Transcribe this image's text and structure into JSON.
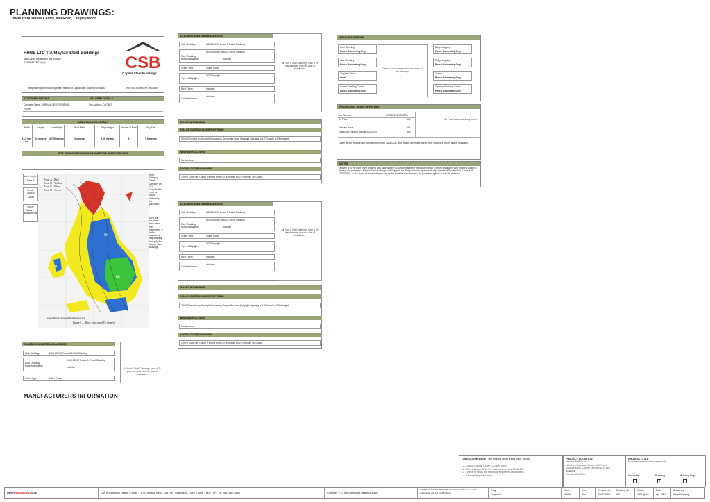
{
  "header": {
    "title": "PLANNING DRAWINGS:",
    "subtitle": "Littleburn Business Centre, Mill Road, Langley Moor"
  },
  "company": {
    "name": "HHGB LTD T/A Mayfair Steel Buildings",
    "address_line1": "Mill Lane, Littleburn Ind Estate",
    "address_line2": "07831027277(ph)",
    "tagline": "Independently owned and operated reseller of Capital Steel Buildings products",
    "logo_text": "Capital Steel Buildings",
    "logo_letters": "CSB",
    "logo_sig": "For the Standard in Steel"
  },
  "customer": {
    "bar_left": "CUSTOMER DETAILS",
    "bar_right": "DELIVERY DETAILS",
    "name_label": "Customer Name:",
    "name_value": "DURHAM SELF STORAGE",
    "phone_label": "Phone:",
    "site_label": "Site Address:",
    "site_value": "DH7 8ET"
  },
  "basic_details": {
    "bar": "BASIC BUILDING DETAILS",
    "headers": [
      "Widt h",
      "Length",
      "Eave Height",
      "Roof Pitch",
      "Ridge Height",
      "Number of Bays",
      "Bay Size"
    ],
    "values": [
      "14.5 met res",
      "15 metres",
      "3.755 metres",
      "10 degrees",
      "5.00 metres",
      "3",
      "5.0 metres"
    ],
    "site_bar": "SITE WIND CONDITIONS & ENGINEERING SPECIFICATIONS"
  },
  "wind": {
    "region_label": "Wind Region",
    "region_value": "Zone A",
    "terrain_label": "Terrain Category",
    "terrain_value": "1.0km",
    "usage_label": "Usage",
    "usage_value": "Class 1 - 30X40/90 BL",
    "zones": [
      "Zone A - Red",
      "Zone B - Yellow",
      "Zone C - Blue",
      "Zone D - Green"
    ],
    "source": "Source: Building Research Establishment Ltd",
    "figure": "Figure 6 — Basic wind speed Vb (in m/s)",
    "side_text_1": "Wind Category, Terrain Category and Use Classification must be clearly defined by the purchaser.",
    "side_text_2": "All of our structures have been fully engineered. It is the customer's responsibility to supply the Mayfair Steel Buildings."
  },
  "cladding_1": {
    "bar": "CLADDING & WATER MANAGEMENT",
    "wall_label": "Wall Cladding:",
    "wall_value": "A024 1000W Posco 0.5 Wall Cladding",
    "roof_label": "Roof Cladding: Anticondensation:",
    "roof_value": "A040 1000R Posco 0.7 Roof Cladding",
    "roof_value2": "Included",
    "gutter_label": "Gutter Type:",
    "gutter_value": "Gutter Posco",
    "sky_label": "Type of Skylights:",
    "sky_value": "A030 Skylight",
    "filler_label": "Roof Fillers:",
    "filler_value": "Included",
    "colorite_label": "Colorite Screws:",
    "colorite_value": "Included",
    "note": "All Roof & Wall Claddings have a 25 year warranty from the date of installation."
  },
  "doors_1": {
    "bar": "DOORS & WINDOWS",
    "roller_bar": "ROLLER DOORS/COLOURS/OPENING",
    "roller_value": "3 X 4.37m wide by 3m high Goosewing Grey roller door, (Daylight Opening is 4.27m wide x 2.9m height)",
    "windows_bar": "WINDOWS/COLOURS",
    "windows_value": "No Windows.",
    "access_bar": "ACCESS DOORS/COLOURS",
    "access_value": "1 X PA Door Self Colour (Hinged Right), 0.90m wide by 2.07m high. No Colour."
  },
  "cladding_2": {
    "bar": "CLADDING & WATER MANAGEMENT",
    "wall_label": "Wall Cladding:",
    "wall_value": "A024 1000W Posco 0.5 Wall Cladding",
    "roof_label": "Roof Cladding: Anticondensation:",
    "roof_value": "A040 1000R Posco 0.7 Roof Cladding",
    "roof_value2": "Included",
    "gutter_label": "Gutter Type:",
    "gutter_value": "Gutter Posco",
    "sky_label": "Type of Skylights:",
    "sky_value": "A030 Skylight",
    "filler_label": "Roof Fillers:",
    "filler_value": "Included",
    "colorite_label": "Colorite Screws:",
    "colorite_value": "Included",
    "note": "All Roof & Wall Claddings have a 25 year warranty from the date of installation."
  },
  "doors_2": {
    "bar": "DOORS & WINDOWS",
    "roller_bar": "ROLLER DOORS/COLOURS/OPENING",
    "roller_value": "3 X 4.37m wide by 3m high Goosewing Grey roller door, (Daylight Opening is 4.27m wide x 2.9m height)",
    "windows_bar": "WINDOWS/COLOURS",
    "windows_value": "No Windows.",
    "access_bar": "ACCESS DOORS/COLOURS",
    "access_value": "1 X PA Door Self Colour (Hinged Right), 0.90m wide by 2.07m high. No Colour."
  },
  "cladding_3": {
    "bar": "CLADDING & WATER MANAGEMENT",
    "wall_label": "Wall Cladding:",
    "wall_value": "A024 1000W Posco 0.5 Wall Cladding",
    "roof_label": "Roof Cladding: Anticondensation:",
    "roof_value": "A040 1000R Posco 0.7 Roof Cladding",
    "roof_value2": "Included",
    "gutter_label": "Gutter Type:",
    "gutter_value": "Gutter Posco",
    "note": "All Roof & Wall Claddings have a 25 year warranty from the date of installation."
  },
  "colour": {
    "bar": "COLOUR SCHEDULE",
    "roof_sheeting_label": "Roof Sheeting:",
    "roof_sheeting_value": "Posco Goosewing Grey",
    "wall_sheeting_label": "Wall Sheeting:",
    "wall_sheeting_value": "Posco Goosewing Grey",
    "skylight_label": "Skylight Colour:",
    "skylight_value": "Clear",
    "corner_label": "Corner Flashing Colour:",
    "corner_value": "Posco Goosewing Grey",
    "barge_label": "Barge Capping:",
    "barge_value": "Posco Goosewing Grey",
    "ridge_label": "Ridge Capping:",
    "ridge_value": "Posco Goosewing Grey",
    "gutter_label": "Gutter:",
    "gutter_value": "Posco Goosewing Grey",
    "opening_label": "Opening Flashing Colour:",
    "opening_value": "Posco Goosewing Grey",
    "note": "Default colours may vary from those on the drawings."
  },
  "pricing": {
    "bar": "PRICING AND TERMS OF PAYMENT",
    "job_label": "Job Number:",
    "job_value": "CCSBP178200337TA",
    "kit_label": "Kit Price:",
    "kit_value": "N/A",
    "kit_note": "Kit Price includes delivery to site.",
    "erection_label": "Erection Price:",
    "erection_value": "N/A",
    "total_label": "Total Cost: (doesn't include VAT/20%)",
    "total_value": "N/A",
    "quote_text": "Quote will be only be valid for one month from 15/06/2017 and may be amended due to price increases, errors and/or omissions.",
    "notes_bar": "NOTES:",
    "notes_text": "Delivery is to the front of the property only, unless there is sufficient area for the delivery truck to return around on your property. Said KIT remains the property of Mayfair Steel Buildings until fully paid for. The purchaser agrees to accept the said KIT within 3 to 4 weeks of ORDERING. In the event of a material price rise by the material manufacturer, the purchaser agrees to pay the increase."
  },
  "manufacturers": "MANUFACTURERS INFORMATION",
  "title_block": {
    "lintel_h": "LINTEL SCHEDULE",
    "lintel_sub": "- Min bearing for all lintels to be 150mm",
    "lintel_items": [
      "L1 - Catnic Cougar CG90 100 steel lintel",
      "L2 - Boumanclare 8216 Pre cast concrete lintel 150x100",
      "L3 - Steels to be as per structural engineers calculations",
      "L4 - Use existing lintel in situ"
    ],
    "location_h": "PROJECT LOCATION",
    "location_lines": [
      "Durham Self Store",
      "Littleburn Business Centre, Mill Road",
      "Langley Moor, County Durham DH7 8ET"
    ],
    "client_h": "CLIENT",
    "client_value": "Durham Self Store",
    "project_h": "PROJECT TITLE",
    "project_value": "Proposed warehouse/storage unit",
    "feasibility": "Feasibility:",
    "planning": "Planning:",
    "building_regs": "Building Regs:",
    "dwg_label": "Dwg",
    "dwg_value": "Proposed",
    "sheet_label": "Sheet",
    "sheet_value": "A3/A4",
    "rev_label": "Rev",
    "rev_value": "A/a",
    "project_no_label": "Project No:",
    "project_no_value": "2017/0123",
    "drawing_no_label": "Drawing No:",
    "drawing_no_value": "001",
    "scale_label": "Scale:",
    "scale_value": "1:50 @ A1",
    "date_label": "Date:",
    "date_value": "Apr 2017",
    "drawn_label": "Drawn by:",
    "drawn_value": "Gary Wheatley"
  },
  "footer": {
    "brand_prefix": "www.",
    "brand_main": "drawingplans",
    "brand_suffix": ".co.uk",
    "address": "G W Architectural Design & Build - 15 St Romano View - Low Fell - Gateshead - Tyne & Wear - NE9 7TP - Tel: 0844 884 25 80",
    "copyright": "Copyright © G W Architectural Design & Build",
    "warning": "WRITTEN DIMENSIONS NOT TO BE SCALED. To be read in conjunction with full specifications"
  }
}
